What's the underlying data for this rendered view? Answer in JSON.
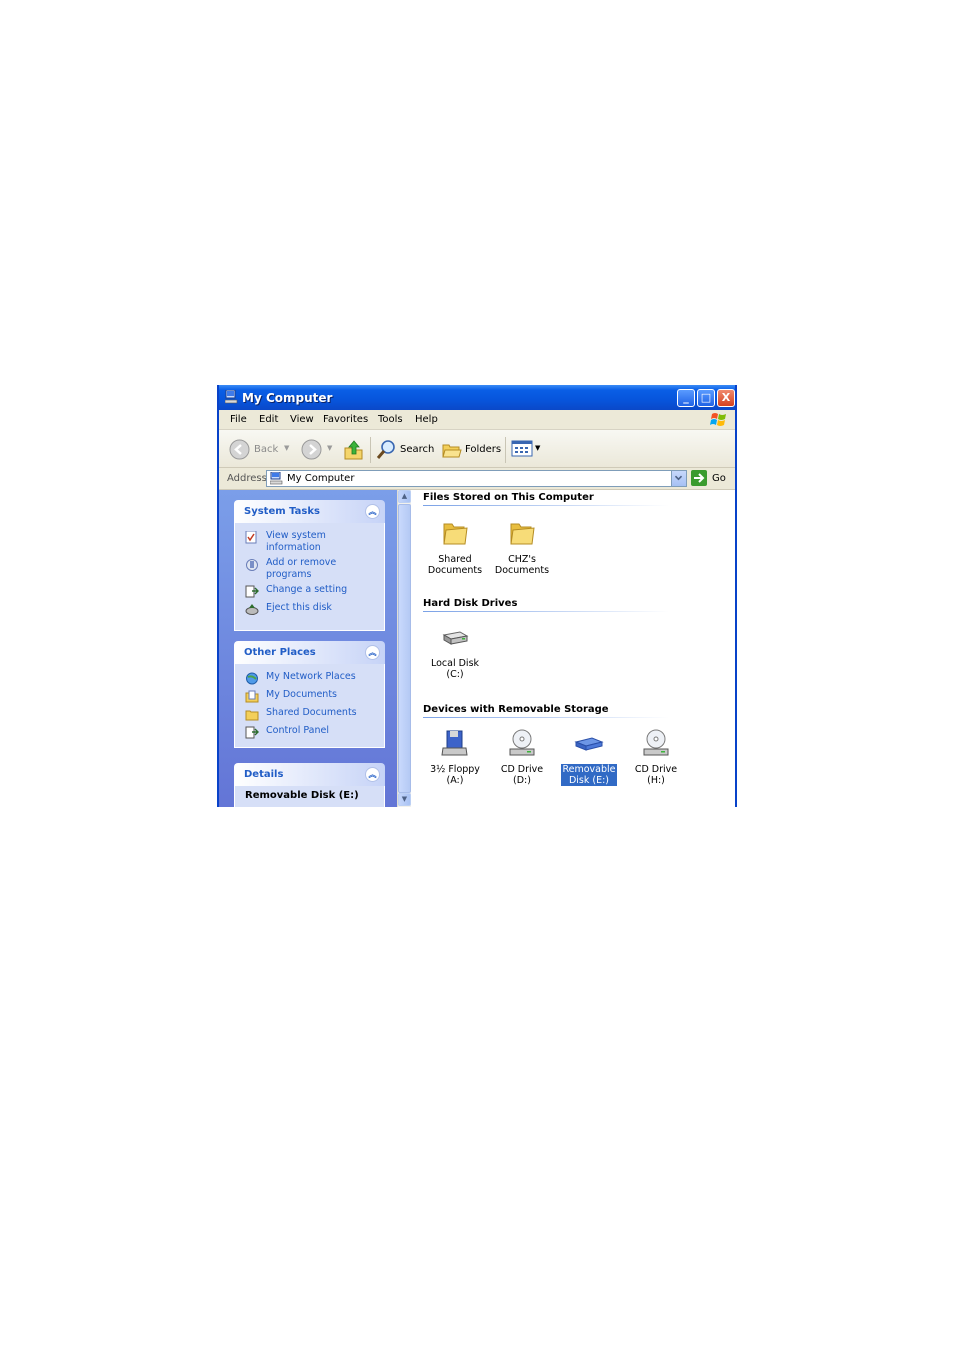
{
  "window": {
    "title": "My Computer",
    "controls": {
      "minimize": "_",
      "maximize": "□",
      "close": "X"
    }
  },
  "menu": [
    "File",
    "Edit",
    "View",
    "Favorites",
    "Tools",
    "Help"
  ],
  "toolbar": {
    "back": "Back",
    "search": "Search",
    "folders": "Folders"
  },
  "address": {
    "label": "Address",
    "value": "My Computer",
    "go": "Go"
  },
  "taskpane": {
    "system_tasks": {
      "title": "System Tasks",
      "items": [
        {
          "label_line1": "View system",
          "label_line2": "information",
          "icon": "system-info-icon"
        },
        {
          "label_line1": "Add or remove",
          "label_line2": "programs",
          "icon": "add-remove-icon"
        },
        {
          "label_line1": "Change a setting",
          "icon": "control-panel-icon"
        },
        {
          "label_line1": "Eject this disk",
          "icon": "eject-icon"
        }
      ]
    },
    "other_places": {
      "title": "Other Places",
      "items": [
        {
          "label": "My Network Places",
          "icon": "network-icon"
        },
        {
          "label": "My Documents",
          "icon": "documents-icon"
        },
        {
          "label": "Shared Documents",
          "icon": "folder-icon"
        },
        {
          "label": "Control Panel",
          "icon": "control-panel-icon"
        }
      ]
    },
    "details": {
      "title": "Details",
      "name": "Removable Disk (E:)"
    }
  },
  "content": {
    "groups": [
      {
        "title": "Files Stored on This Computer",
        "items": [
          {
            "line1": "Shared",
            "line2": "Documents",
            "icon": "folder-icon"
          },
          {
            "line1": "CHZ's",
            "line2": "Documents",
            "icon": "folder-icon"
          }
        ]
      },
      {
        "title": "Hard Disk Drives",
        "items": [
          {
            "line1": "Local Disk (C:)",
            "line2": "",
            "icon": "hard-disk-icon"
          }
        ]
      },
      {
        "title": "Devices with Removable Storage",
        "items": [
          {
            "line1": "3½ Floppy",
            "line2": "(A:)",
            "icon": "floppy-icon"
          },
          {
            "line1": "CD Drive (D:)",
            "line2": "",
            "icon": "cd-drive-icon"
          },
          {
            "line1": "Removable",
            "line2": "Disk (E:)",
            "icon": "removable-disk-icon"
          },
          {
            "line1": "CD Drive (H:)",
            "line2": "",
            "icon": "cd-drive-icon"
          }
        ]
      }
    ]
  },
  "colors": {
    "title_bar": "#0755dc",
    "task_pane": "#6f8ae0",
    "link": "#215dc6",
    "selection": "#316ac5"
  }
}
